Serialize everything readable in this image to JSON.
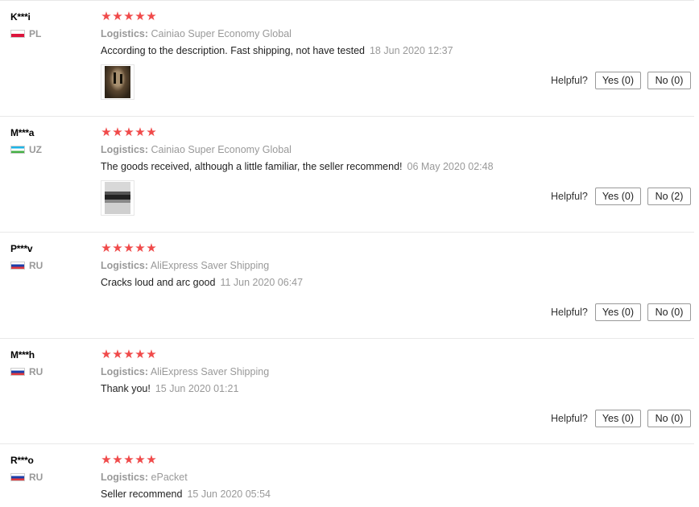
{
  "helpful_label": "Helpful?",
  "logistics_label": "Logistics:",
  "star_glyph": "★",
  "colors": {
    "star": "#f04a4a",
    "muted": "#999999",
    "text": "#222222"
  },
  "reviews": [
    {
      "user": "K***i",
      "country": "PL",
      "flag": "pl",
      "logistics": "Cainiao Super Economy Global",
      "feedback": "According to the description. Fast shipping, not have tested",
      "date": "18 Jun 2020 12:37",
      "has_photo": true,
      "yes": "Yes (0)",
      "no": "No (0)"
    },
    {
      "user": "M***a",
      "country": "UZ",
      "flag": "uz",
      "logistics": "Cainiao Super Economy Global",
      "feedback": "The goods received, although a little familiar, the seller recommend!",
      "date": "06 May 2020 02:48",
      "has_photo": true,
      "yes": "Yes (0)",
      "no": "No (2)"
    },
    {
      "user": "P***v",
      "country": "RU",
      "flag": "ru",
      "logistics": "AliExpress Saver Shipping",
      "feedback": "Cracks loud and arc good",
      "date": "11 Jun 2020 06:47",
      "has_photo": false,
      "yes": "Yes (0)",
      "no": "No (0)"
    },
    {
      "user": "M***h",
      "country": "RU",
      "flag": "ru",
      "logistics": "AliExpress Saver Shipping",
      "feedback": "Thank you!",
      "date": "15 Jun 2020 01:21",
      "has_photo": false,
      "yes": "Yes (0)",
      "no": "No (0)"
    },
    {
      "user": "R***o",
      "country": "RU",
      "flag": "ru",
      "logistics": "ePacket",
      "feedback": "Seller recommend",
      "date": "15 Jun 2020 05:54",
      "has_photo": false,
      "yes": "",
      "no": ""
    }
  ]
}
